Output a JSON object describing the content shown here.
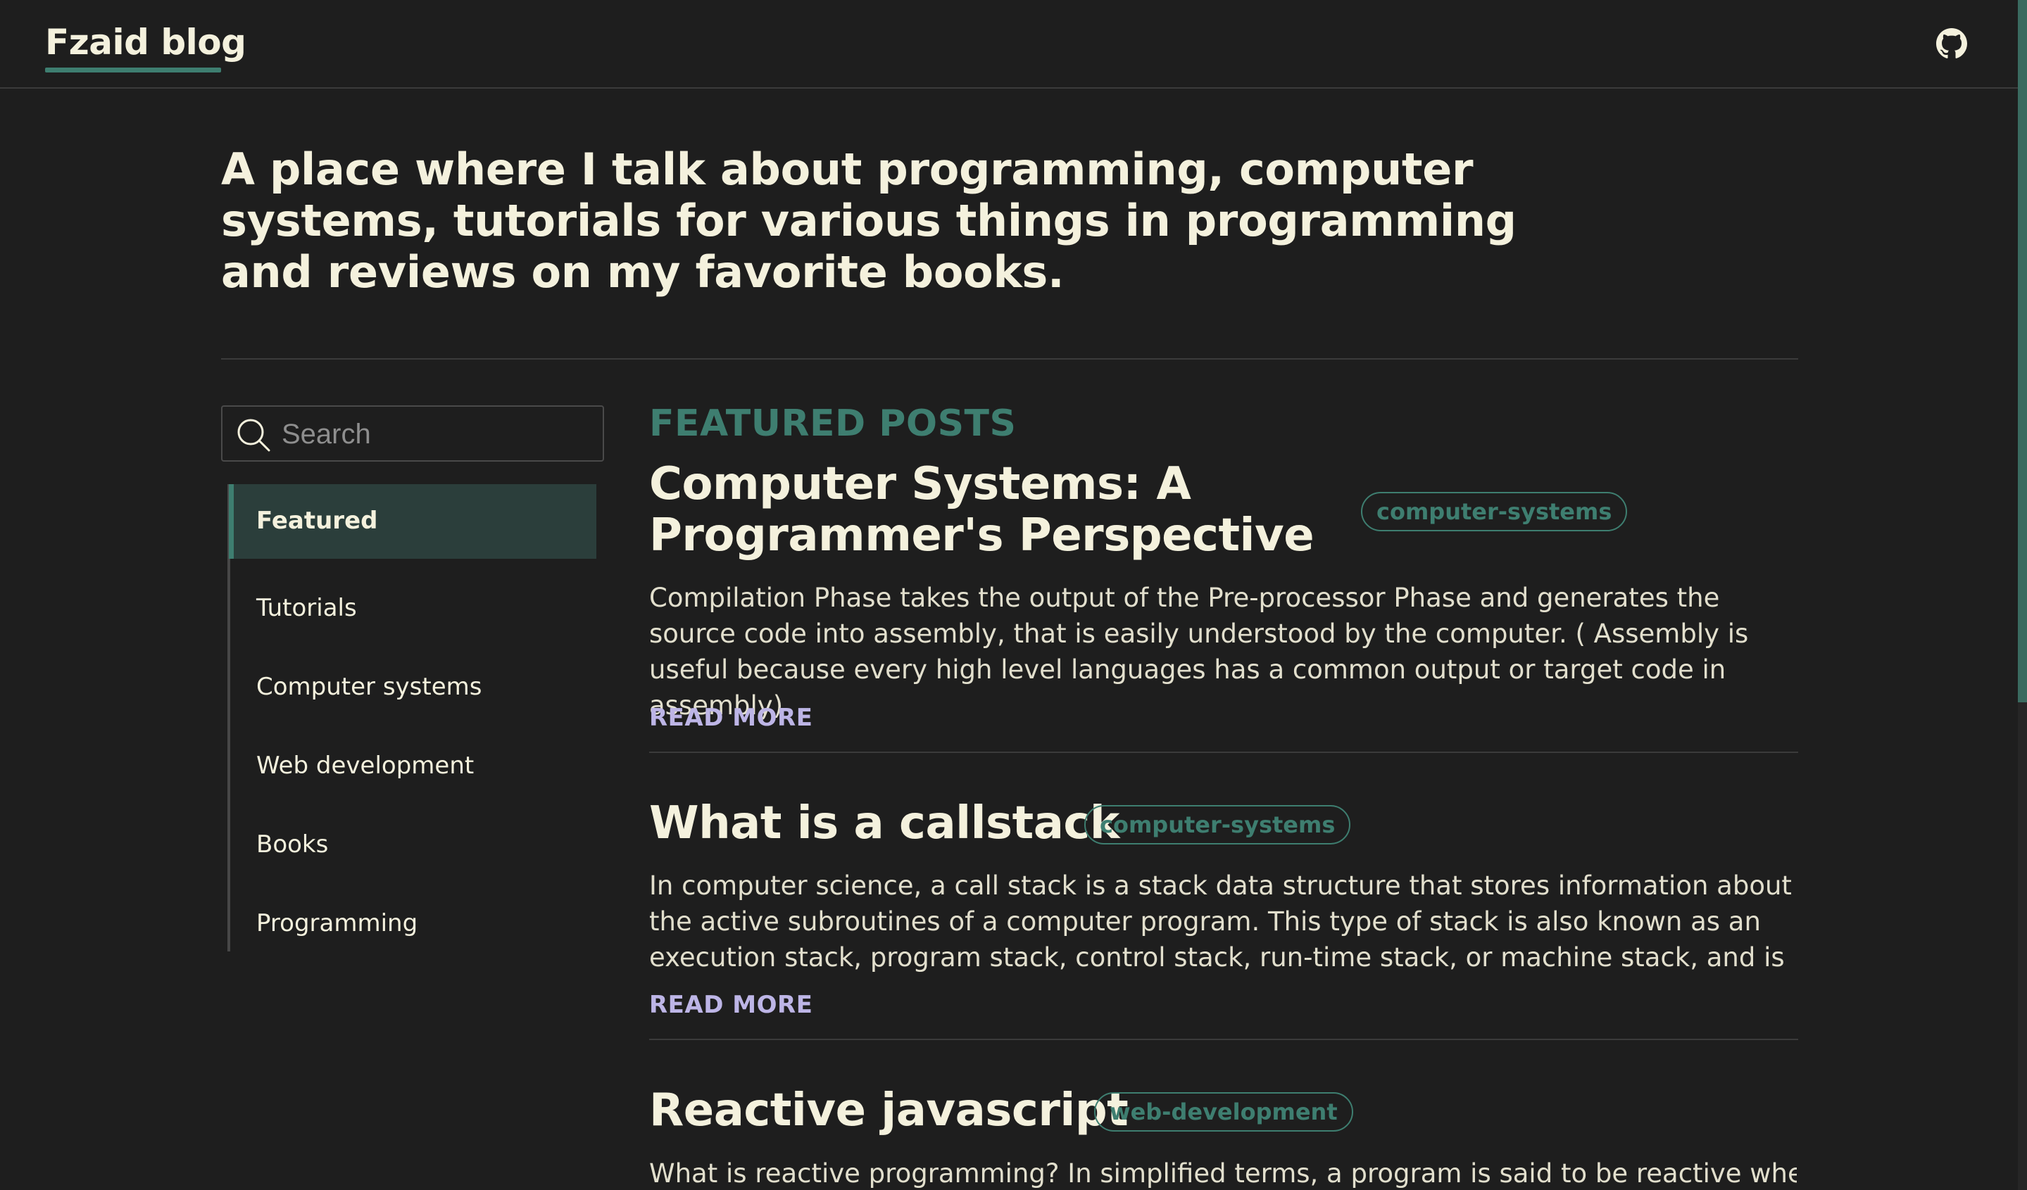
{
  "header": {
    "brand": "Fzaid blog",
    "github_icon": "github-icon"
  },
  "intro": "A place where I talk about programming, computer systems, tutorials for various things in programming and reviews on my favorite books.",
  "search": {
    "placeholder": "Search",
    "value": "",
    "icon": "search-icon"
  },
  "sidebar": {
    "items": [
      {
        "label": "Featured",
        "active": true
      },
      {
        "label": "Tutorials",
        "active": false
      },
      {
        "label": "Computer systems",
        "active": false
      },
      {
        "label": "Web development",
        "active": false
      },
      {
        "label": "Books",
        "active": false
      },
      {
        "label": "Programming",
        "active": false
      }
    ]
  },
  "main": {
    "section_label": "FEATURED POSTS",
    "read_more_label": "READ MORE",
    "posts": [
      {
        "title_lines": [
          "Computer Systems: A",
          "Programmer's Perspective"
        ],
        "tag": "computer-systems",
        "excerpt": "Compilation Phase takes the output of the Pre-processor Phase and generates the source code into assembly, that is easily understood by the computer. ( Assembly is useful because every high level languages has a common output or target code in assembly)"
      },
      {
        "title": "What is a callstack",
        "tag": "computer-systems",
        "excerpt": "In computer science, a call stack is a stack data structure that stores information about the active subroutines of a computer program. This type of stack is also known as an execution stack, program stack, control stack, run-time stack, or machine stack, and is often shortened t..."
      },
      {
        "title": "Reactive javascript",
        "tag": "web-development",
        "excerpt": "What is reactive programming? In simplified terms, a program is said to be reactive when an"
      }
    ]
  },
  "colors": {
    "background": "#1e1e1e",
    "accent": "#3e7e70",
    "text": "#f4f1dd",
    "link": "#bdb5e6",
    "active_nav_bg": "#2b3e3b"
  }
}
